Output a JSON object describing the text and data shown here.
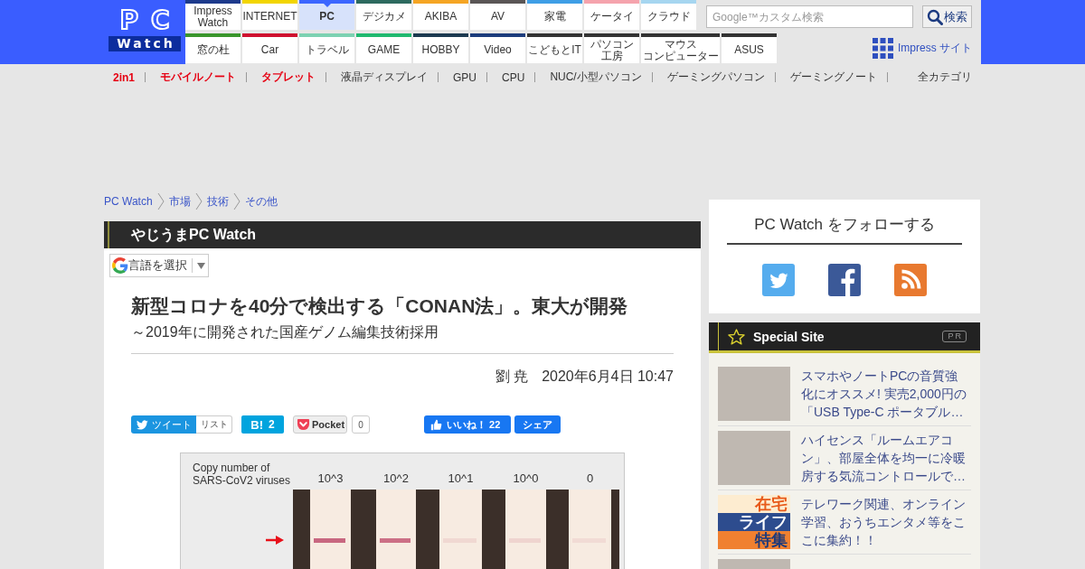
{
  "header": {
    "logo": {
      "letters": "PC",
      "banner": "Watch"
    },
    "nav": [
      {
        "tiles": [
          {
            "lines": [
              "Impress",
              "Watch"
            ],
            "color": "#1d3a8c",
            "selected": false,
            "kind": "standard"
          },
          {
            "lines": [
              "INTERNET"
            ],
            "color": "#f2d500",
            "selected": false,
            "kind": "standard"
          },
          {
            "lines": [
              "PC"
            ],
            "color": "#3b66ff",
            "selected": true,
            "kind": "standard"
          },
          {
            "lines": [
              "デジカメ"
            ],
            "color": "#2d6a5f",
            "selected": false,
            "kind": "standard"
          },
          {
            "lines": [
              "AKIBA"
            ],
            "color": "#f5a524",
            "selected": false,
            "kind": "standard"
          },
          {
            "lines": [
              "AV"
            ],
            "color": "#5a5656",
            "selected": false,
            "kind": "standard"
          },
          {
            "lines": [
              "家電"
            ],
            "color": "#3f9ee6",
            "selected": false,
            "kind": "standard"
          },
          {
            "lines": [
              "ケータイ"
            ],
            "color": "#f5a3ad",
            "selected": false,
            "kind": "standard"
          },
          {
            "lines": [
              "クラウド"
            ],
            "color": "#a6d6f0",
            "selected": false,
            "kind": "standard"
          }
        ]
      },
      {
        "tiles": [
          {
            "lines": [
              "窓の杜"
            ],
            "color": "#3a962c",
            "selected": false,
            "kind": "standard"
          },
          {
            "lines": [
              "Car"
            ],
            "color": "#cf1030",
            "selected": false,
            "kind": "standard"
          },
          {
            "lines": [
              "トラベル"
            ],
            "color": "#7dd2b2",
            "selected": false,
            "kind": "standard"
          },
          {
            "lines": [
              "GAME"
            ],
            "color": "#20b970",
            "selected": false,
            "kind": "standard"
          },
          {
            "lines": [
              "HOBBY"
            ],
            "color": "#1c3a50",
            "selected": false,
            "kind": "standard"
          },
          {
            "lines": [
              "Video"
            ],
            "color": "#1c3c7c",
            "selected": false,
            "kind": "standard"
          },
          {
            "lines": [
              "こどもとIT"
            ],
            "color": "#333333",
            "selected": false,
            "kind": "standard"
          },
          {
            "lines": [
              "パソコン",
              "工房"
            ],
            "color": "#333333",
            "selected": false,
            "kind": "standard"
          },
          {
            "lines": [
              "マウス",
              "コンピューター"
            ],
            "color": "#333333",
            "selected": false,
            "kind": "compact"
          },
          {
            "lines": [
              "ASUS"
            ],
            "color": "#333333",
            "selected": false,
            "kind": "standard"
          }
        ]
      }
    ],
    "search": {
      "placeholder": "Google™カスタム検索",
      "button": "検索"
    },
    "sites_link": "Impress サイト"
  },
  "category_bar": {
    "items": [
      {
        "label": "2in1",
        "highlighted": true
      },
      {
        "label": "モバイルノート",
        "highlighted": true
      },
      {
        "label": "タブレット",
        "highlighted": true
      },
      {
        "label": "液晶ディスプレイ",
        "highlighted": false
      },
      {
        "label": "GPU",
        "highlighted": false
      },
      {
        "label": "CPU",
        "highlighted": false
      },
      {
        "label": "NUC/小型パソコン",
        "highlighted": false
      },
      {
        "label": "ゲーミングパソコン",
        "highlighted": false
      },
      {
        "label": "ゲーミングノート",
        "highlighted": false
      }
    ],
    "all_link": "全カテゴリ"
  },
  "breadcrumb": [
    "PC Watch",
    "市場",
    "技術",
    "その他"
  ],
  "article": {
    "section": "やじうまPC Watch",
    "translate": "言語を選択",
    "title": "新型コロナを40分で検出する「CONAN法」。東大が開発",
    "subtitle": "～2019年に開発された国産ゲノム編集技術採用",
    "author": "劉 尭",
    "date": "2020年6月4日 10:47",
    "share": {
      "tweet": "ツイート",
      "list": "リスト",
      "hatena": {
        "label": "B!",
        "count": "2"
      },
      "pocket": {
        "label": "Pocket",
        "count": "0"
      },
      "like": {
        "label": "いいね！",
        "count": "22"
      },
      "share": "シェア"
    },
    "figure": {
      "axis_label": "Copy number of SARS-CoV2 viruses",
      "columns": [
        "10^3",
        "10^2",
        "10^1",
        "10^0",
        "0"
      ]
    }
  },
  "sidebar": {
    "follow": {
      "title": "PC Watch をフォローする"
    },
    "special": {
      "title": "Special Site",
      "badge": "PR",
      "items": [
        {
          "kind": "photo",
          "text": "スマホやノートPCの音質強化にオススメ! 実売2,000円の「USB Type-C ポータブル…"
        },
        {
          "kind": "photo",
          "text": "ハイセンス「ルームエアコン」、部屋全体を均一に冷暖房する気流コントロールで…"
        },
        {
          "kind": "banner",
          "banner": [
            "在宅",
            "ライフ",
            "特集"
          ],
          "text": "テレワーク関連、オンライン学習、おうちエンタメ等をここに集約！！"
        },
        {
          "kind": "photo"
        }
      ]
    }
  }
}
